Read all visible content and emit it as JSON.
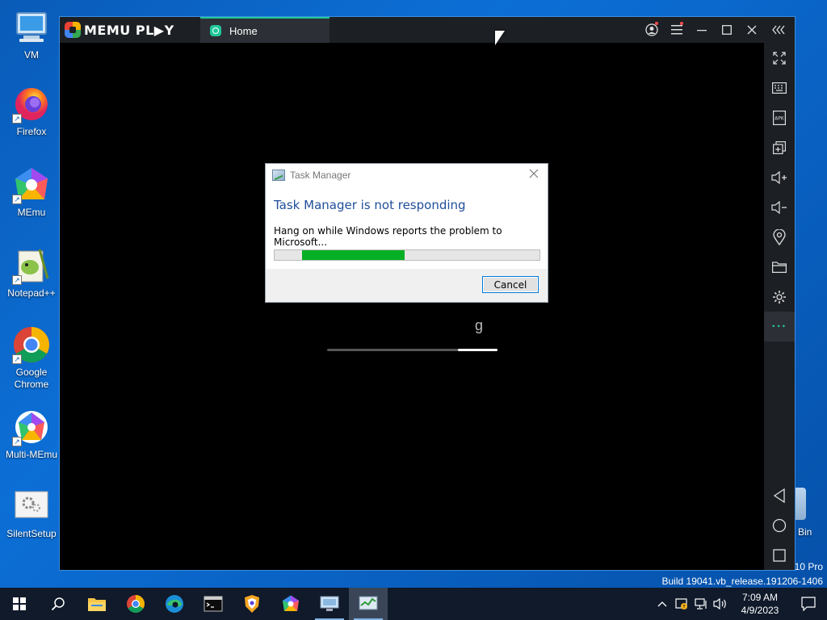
{
  "desktop": {
    "icons": [
      {
        "label": "VM",
        "icon": "computer-icon"
      },
      {
        "label": "Firefox",
        "icon": "firefox-icon"
      },
      {
        "label": "MEmu",
        "icon": "memu-icon"
      },
      {
        "label": "Notepad++",
        "icon": "notepadpp-icon"
      },
      {
        "label": "Google Chrome",
        "icon": "chrome-icon"
      },
      {
        "label": "Multi-MEmu",
        "icon": "multi-memu-icon"
      },
      {
        "label": "SilentSetup",
        "icon": "setup-icon"
      }
    ],
    "recycle_bin_label": "Bin",
    "watermark_line1": "10 Pro",
    "watermark_line2": "Build 19041.vb_release.191206-1406"
  },
  "memu": {
    "logo_text": "MEMU PL▶Y",
    "tab_label": "Home",
    "sidebar_icons": [
      "fullscreen-icon",
      "keyboard-icon",
      "apk-icon",
      "multi-window-icon",
      "volume-up-icon",
      "volume-down-icon",
      "location-icon",
      "folder-icon",
      "settings-icon",
      "more-icon"
    ],
    "nav_icons": [
      "back-icon",
      "home-icon",
      "recents-icon"
    ],
    "partial_glyph": "g",
    "loading_progress": 0.23
  },
  "dialog": {
    "title": "Task Manager",
    "heading": "Task Manager is not responding",
    "message": "Hang on while Windows reports the problem to Microsoft...",
    "cancel_label": "Cancel",
    "progress_segment_start": 0.105,
    "progress_segment_end": 0.49
  },
  "taskbar": {
    "apps": [
      "file-explorer-icon",
      "chrome-icon",
      "edge-icon",
      "terminal-icon",
      "brave-icon",
      "memu-icon",
      "remote-desktop-icon",
      "task-manager-icon"
    ],
    "time": "7:09 AM",
    "date": "4/9/2023"
  },
  "colors": {
    "accent": "#1fc79a",
    "dialog_heading": "#1f4e99",
    "progress": "#06b025",
    "desktop": "#0c6fd6"
  }
}
